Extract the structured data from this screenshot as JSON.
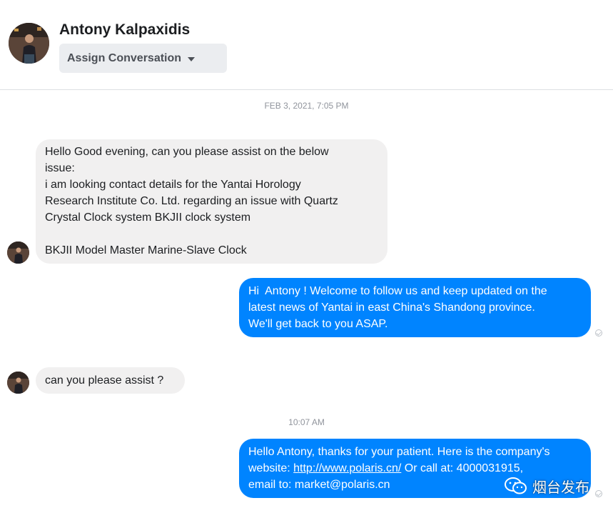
{
  "header": {
    "contact_name": "Antony Kalpaxidis",
    "assign_label": "Assign Conversation"
  },
  "timestamps": {
    "first": "FEB 3, 2021, 7:05 PM",
    "second": "10:07 AM"
  },
  "messages": [
    {
      "direction": "incoming",
      "text": "Hello Good evening, can you please assist on the below\nissue:\ni am looking contact details for the Yantai Horology\nResearch Institute Co. Ltd. regarding an issue with Quartz\nCrystal Clock system BKJII clock system\n\nBKJII Model Master Marine-Slave Clock"
    },
    {
      "direction": "outgoing",
      "text": "Hi  Antony ! Welcome to follow us and keep updated on the\nlatest news of Yantai in east China's Shandong province.\nWe'll get back to you ASAP."
    },
    {
      "direction": "incoming",
      "text": "can you please assist ?"
    },
    {
      "direction": "outgoing",
      "text_before_link": "Hello Antony, thanks for your patient. Here is the company's\nwebsite: ",
      "link": "http://www.polaris.cn/",
      "text_after_link": " Or call at: 4000031915,\nemail to: market@polaris.cn"
    }
  ],
  "watermark": {
    "text": "烟台发布",
    "icon": "wechat-icon"
  },
  "colors": {
    "outgoing_bubble": "#0084ff",
    "incoming_bubble": "#f1f0f0",
    "assign_button_bg": "#ebedf0"
  }
}
